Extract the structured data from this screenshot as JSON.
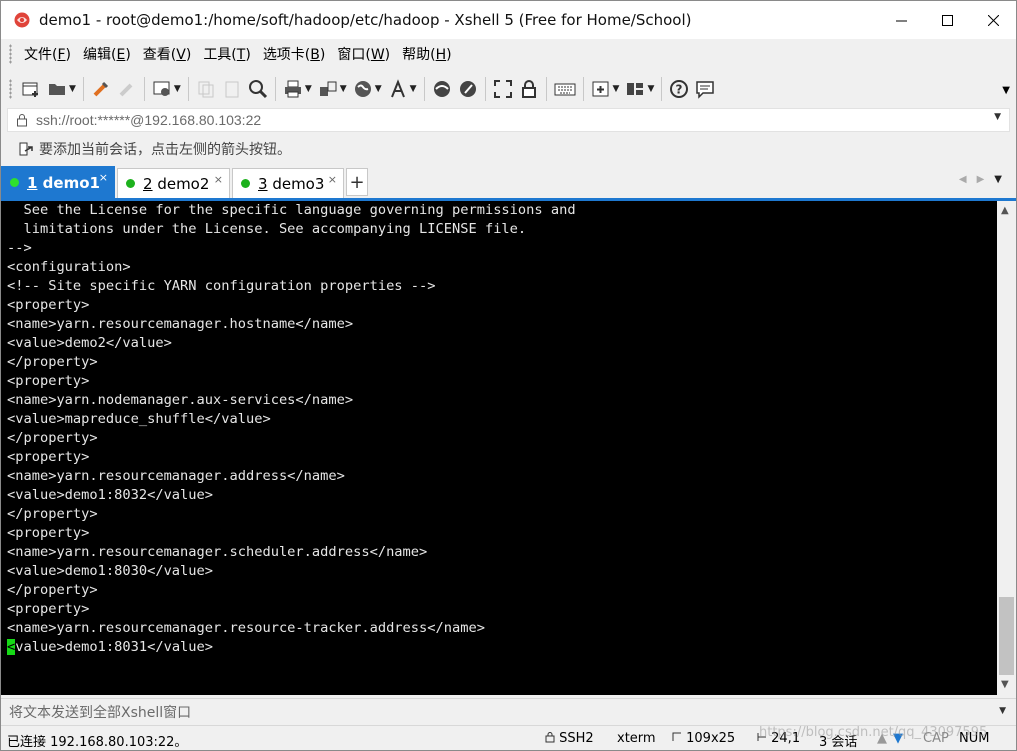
{
  "window": {
    "title": "demo1 - root@demo1:/home/soft/hadoop/etc/hadoop - Xshell 5 (Free for Home/School)"
  },
  "menu": [
    {
      "label": "文件(",
      "key": "F",
      "suffix": ")"
    },
    {
      "label": "编辑(",
      "key": "E",
      "suffix": ")"
    },
    {
      "label": "查看(",
      "key": "V",
      "suffix": ")"
    },
    {
      "label": "工具(",
      "key": "T",
      "suffix": ")"
    },
    {
      "label": "选项卡(",
      "key": "B",
      "suffix": ")"
    },
    {
      "label": "窗口(",
      "key": "W",
      "suffix": ")"
    },
    {
      "label": "帮助(",
      "key": "H",
      "suffix": ")"
    }
  ],
  "address": {
    "value": "ssh://root:******@192.168.80.103:22"
  },
  "hint": {
    "text": "要添加当前会话，点击左侧的箭头按钮。"
  },
  "tabs": [
    {
      "number": "1",
      "name": " demo1",
      "active": true
    },
    {
      "number": "2",
      "name": " demo2",
      "active": false
    },
    {
      "number": "3",
      "name": " demo3",
      "active": false
    }
  ],
  "terminal": {
    "lines": [
      "  See the License for the specific language governing permissions and",
      "  limitations under the License. See accompanying LICENSE file.",
      "-->",
      "<configuration>",
      "<!-- Site specific YARN configuration properties -->",
      "<property>",
      "<name>yarn.resourcemanager.hostname</name>",
      "<value>demo2</value>",
      "</property>",
      "<property>",
      "<name>yarn.nodemanager.aux-services</name>",
      "<value>mapreduce_shuffle</value>",
      "</property>",
      "<property>",
      "<name>yarn.resourcemanager.address</name>",
      "<value>demo1:8032</value>",
      "</property>",
      "<property>",
      "<name>yarn.resourcemanager.scheduler.address</name>",
      "<value>demo1:8030</value>",
      "</property>",
      "<property>",
      "<name>yarn.resourcemanager.resource-tracker.address</name>"
    ],
    "cursor_char": "<",
    "cursor_line_rest": "value>demo1:8031</value>"
  },
  "compose": {
    "placeholder": "将文本发送到全部Xshell窗口"
  },
  "status": {
    "connection": "已连接 192.168.80.103:22。",
    "protocol": "SSH2",
    "terminal_type": "xterm",
    "size": "109x25",
    "position": "24,1",
    "sessions": "3 会话",
    "cap": "CAP",
    "num": "NUM"
  },
  "watermark": {
    "text": "https://blog.csdn.net/qq_43097595"
  },
  "colors": {
    "tab_active": "#1e78d0",
    "session_dot": "#1db11d",
    "cursor": "#16d916",
    "terminal_bg": "#000000"
  }
}
